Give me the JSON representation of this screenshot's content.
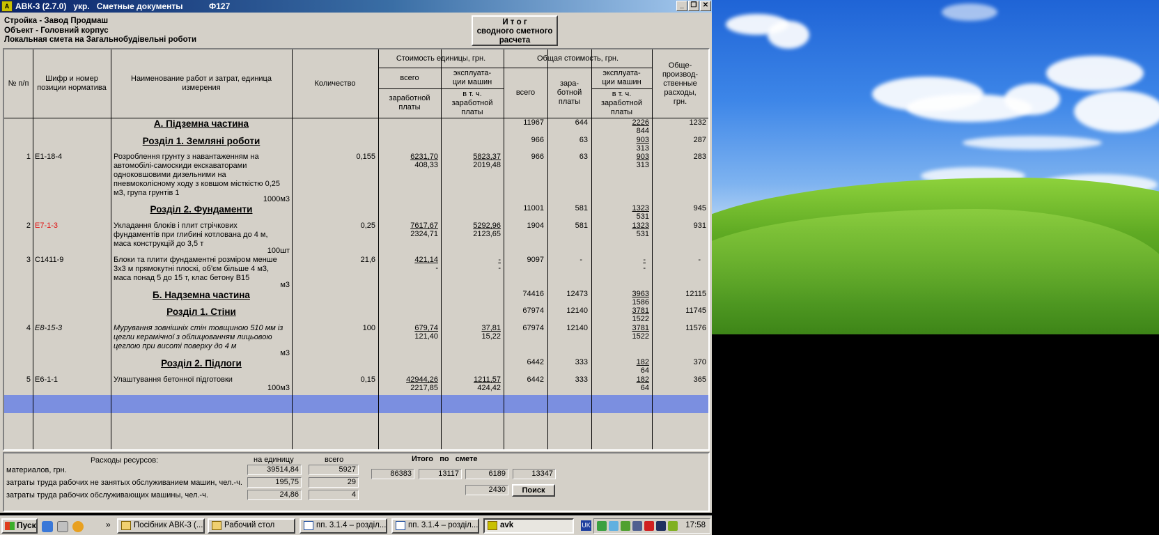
{
  "window": {
    "title": "АВК-3 (2.7.0)   укр.   Сметные документы",
    "code": "Ф127",
    "controls": [
      "minimize",
      "restore",
      "close"
    ]
  },
  "header": {
    "line1": "Стройка - Завод Продмаш",
    "line2": "Объект - Головний корпус",
    "line3": "Локальная смета на Загальнобудівельні роботи",
    "total_button": [
      "И т о г",
      "сводного сметного",
      "расчета"
    ]
  },
  "columns": {
    "num": "№ п/п",
    "code": "Шифр и номер позиции норматива",
    "name": "Наименование работ и затрат, единица измерения",
    "qty": "Количество",
    "unit_cost": "Стоимость единицы, грн.",
    "total_cost": "Общая стоимость, грн.",
    "all": "всего",
    "machine_ops": "эксплуата- ции машин",
    "wages": "заработной платы",
    "incl_wages": "в т. ч. заработной платы",
    "total_all": "всего",
    "total_wages": "зара- ботной платы",
    "total_machine": "эксплуата- ции машин",
    "total_machine_wages": "в т. ч. заработной платы",
    "overhead": "Обще- производ- ственные расходы, грн."
  },
  "rows": {
    "secA": {
      "title": "А.   Підземна частина",
      "total": "11967",
      "wages": "644",
      "mach": "2226",
      "mach2": "844",
      "overhead": "1232"
    },
    "sec1": {
      "title": "Розділ 1. Земляні роботи",
      "total": "966",
      "wages": "63",
      "mach": "903",
      "mach2": "313",
      "overhead": "287"
    },
    "item1": {
      "num": "1",
      "code": "Е1-18-4",
      "desc": "Розроблення грунту з навантаженням на автомобілі-самоскиди екскаваторами одноковшовими дизельними на пневмоколісному ходу з ковшом місткістю 0,25 м3, група грунтів 1",
      "unit": "1000м3",
      "qty": "0,155",
      "uc_all": "6231,70",
      "uc_wages": "408,33",
      "uc_mach": "5823,37",
      "uc_mach_wages": "2019,48",
      "total": "966",
      "wages": "63",
      "mach": "903",
      "mach2": "313",
      "overhead": "283"
    },
    "sec2": {
      "title": "Розділ 2. Фундаменти",
      "total": "11001",
      "wages": "581",
      "mach": "1323",
      "mach2": "531",
      "overhead": "945"
    },
    "item2": {
      "num": "2",
      "code": "Е7-1-3",
      "desc": "Укладання блоків і плит стрічкових фундаментів при глибині котлована до 4 м, маса конструкцій до 3,5 т",
      "unit": "100шт",
      "qty": "0,25",
      "uc_all": "7617,67",
      "uc_wages": "2324,71",
      "uc_mach": "5292,96",
      "uc_mach_wages": "2123,65",
      "total": "1904",
      "wages": "581",
      "mach": "1323",
      "mach2": "531",
      "overhead": "931"
    },
    "item3": {
      "num": "3",
      "code": "С1411-9",
      "desc": "Блоки та плити фундаментні розміром менше 3х3 м прямокутні плоскі, об'єм більше 4 м3, маса понад 5 до 15 т, клас бетону В15",
      "unit": "м3",
      "qty": "21,6",
      "uc_all": "421,14",
      "uc_wages": "-",
      "uc_mach": "-",
      "uc_mach_wages": "-",
      "total": "9097",
      "wages": "-",
      "mach": "-",
      "mach2": "-",
      "overhead": "-"
    },
    "secB": {
      "title": "Б.   Надземна частина",
      "total": "74416",
      "wages": "12473",
      "mach": "3963",
      "mach2": "1586",
      "overhead": "12115"
    },
    "sec3": {
      "title": "Розділ 1. Стіни",
      "total": "67974",
      "wages": "12140",
      "mach": "3781",
      "mach2": "1522",
      "overhead": "11745"
    },
    "item4": {
      "num": "4",
      "code": "Е8-15-3",
      "desc": "Мурування зовнішніх стін товщиною 510 мм із цегли керамічної з облицюванням лицьовою цеглою при висоті поверху до 4 м",
      "unit": "м3",
      "qty": "100",
      "uc_all": "679,74",
      "uc_wages": "121,40",
      "uc_mach": "37,81",
      "uc_mach_wages": "15,22",
      "total": "67974",
      "wages": "12140",
      "mach": "3781",
      "mach2": "1522",
      "overhead": "11576"
    },
    "sec4": {
      "title": "Розділ 2. Підлоги",
      "total": "6442",
      "wages": "333",
      "mach": "182",
      "mach2": "64",
      "overhead": "370"
    },
    "item5": {
      "num": "5",
      "code": "Е6-1-1",
      "desc": "Улаштування бетонної підготовки",
      "unit": "100м3",
      "qty": "0,15",
      "uc_all": "42944,26",
      "uc_wages": "2217,85",
      "uc_mach": "1211,57",
      "uc_mach_wages": "424,42",
      "total": "6442",
      "wages": "333",
      "mach": "182",
      "mach2": "64",
      "overhead": "365"
    }
  },
  "resources": {
    "title": "Расходы ресурсов:",
    "per_unit": "на единицу",
    "all": "всего",
    "rows": [
      {
        "label": "материалов, грн.",
        "unit": "39514,84",
        "all": "5927"
      },
      {
        "label": "затраты труда рабочих не занятых обслуживанием машин, чел.-ч.",
        "unit": "195,75",
        "all": "29"
      },
      {
        "label": "затраты труда рабочих обслуживающих машины, чел.-ч.",
        "unit": "24,86",
        "all": "4"
      }
    ]
  },
  "totals": {
    "title": "Итого   по   смете",
    "v1": "86383",
    "v2": "13117",
    "v3": "6189",
    "v4": "13347",
    "v5": "2430",
    "search": "Поиск"
  },
  "taskbar": {
    "start": "Пуск",
    "chevron": "»",
    "tasks": [
      "Посібник АВК-3 (...",
      "Рабочий стол",
      "пп. 3.1.4 – розділ...",
      "пп. 3.1.4 – розділ...",
      "avk"
    ],
    "lang": "UK",
    "clock": "17:58"
  }
}
